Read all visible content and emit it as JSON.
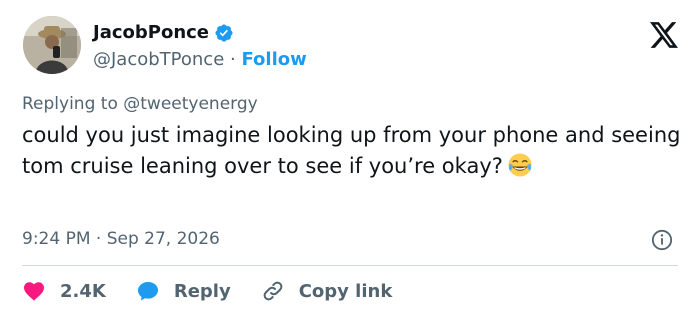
{
  "author": {
    "display_name": "JacobPonce",
    "handle": "@JacobTPonce",
    "separator": "·",
    "follow_label": "Follow"
  },
  "reply": {
    "prefix": "Replying to",
    "mention": "@tweetyenergy"
  },
  "tweet": {
    "text": "could you just imagine looking up from your phone and seeing tom cruise leaning over to see if you’re okay?",
    "emoji": "face-with-tears-of-joy"
  },
  "meta": {
    "time": "9:24 PM",
    "separator": "·",
    "date": "Sep 27, 2026"
  },
  "actions": {
    "likes": "2.4K",
    "reply_label": "Reply",
    "copy_link_label": "Copy link"
  },
  "colors": {
    "accent": "#1d9bf0",
    "like": "#f91880",
    "text": "#0f1419",
    "muted": "#536471"
  }
}
